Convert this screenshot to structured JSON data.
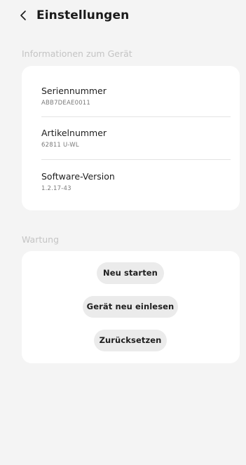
{
  "header": {
    "title": "Einstellungen",
    "back_icon": "chevron-left-icon"
  },
  "device_info": {
    "section_label": "Informationen zum Gerät",
    "rows": [
      {
        "label": "Seriennummer",
        "value": "ABB7DEAE0011"
      },
      {
        "label": "Artikelnummer",
        "value": "62811 U-WL"
      },
      {
        "label": "Software-Version",
        "value": "1.2.17-43"
      }
    ]
  },
  "maintenance": {
    "section_label": "Wartung",
    "buttons": [
      {
        "label": "Neu starten"
      },
      {
        "label": "Gerät neu einlesen"
      },
      {
        "label": "Zurücksetzen"
      }
    ]
  }
}
